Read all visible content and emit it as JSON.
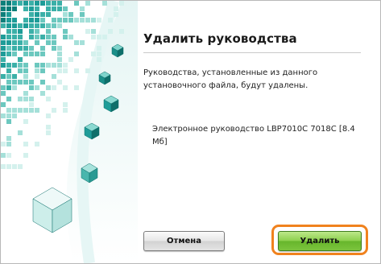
{
  "dialog": {
    "title": "Удалить руководства",
    "description": "Руководства, установленные из данного установочного файла, будут удалены.",
    "items": [
      {
        "label": "Электронное руководство LBP7010C 7018C [8.4 Мб]"
      }
    ]
  },
  "buttons": {
    "cancel_label": "Отмена",
    "delete_label": "Удалить"
  },
  "colors": {
    "accent_highlight": "#f0821e",
    "primary_button": "#7cc43d",
    "art_teal": "#1e9c98"
  },
  "icons": {
    "decoration": "teal-cubes-illustration"
  }
}
